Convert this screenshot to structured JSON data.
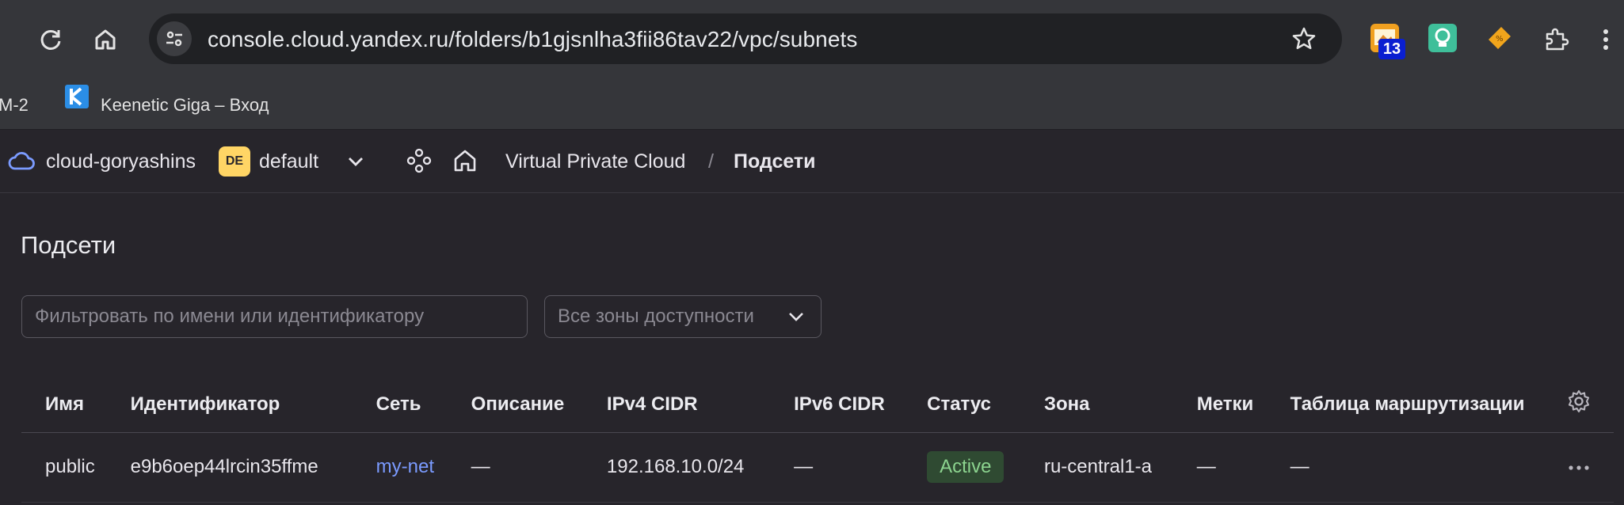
{
  "browser": {
    "url": "console.cloud.yandex.ru/folders/b1gjsnlha3fii86tav22/vpc/subnets",
    "extension_badge": "13",
    "bookmarks": [
      {
        "label": "M-2"
      },
      {
        "label": "Keenetic Giga – Вход",
        "icon": "keenetic-k-icon"
      }
    ]
  },
  "header": {
    "cloud_name": "cloud-goryashins",
    "folder_badge": "DE",
    "folder_name": "default",
    "breadcrumb_service": "Virtual Private Cloud",
    "breadcrumb_separator": "/",
    "breadcrumb_current": "Подсети"
  },
  "page": {
    "title": "Подсети",
    "filter_placeholder": "Фильтровать по имени или идентификатору",
    "zone_select_value": "Все зоны доступности"
  },
  "table": {
    "columns": [
      "Имя",
      "Идентификатор",
      "Сеть",
      "Описание",
      "IPv4 CIDR",
      "IPv6 CIDR",
      "Статус",
      "Зона",
      "Метки",
      "Таблица маршрутизации"
    ],
    "rows": [
      {
        "name": "public",
        "id": "e9b6oep44lrcin35ffme",
        "network": "my-net",
        "description": "—",
        "ipv4": "192.168.10.0/24",
        "ipv6": "—",
        "status": "Active",
        "zone": "ru-central1-a",
        "labels": "—",
        "route_table": "—"
      }
    ]
  },
  "colors": {
    "background": "#27252b",
    "chrome": "#35363a",
    "link": "#7b9bff",
    "status_active_bg": "#2f4a32",
    "status_active_text": "#8cd48f",
    "folder_badge": "#ffd565"
  }
}
